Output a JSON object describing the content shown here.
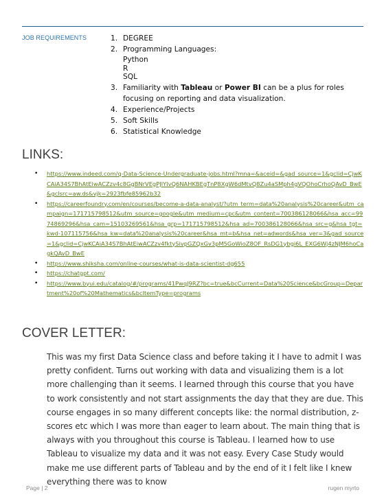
{
  "job_requirements": {
    "label": "JOB REQUIREMENTS",
    "items": [
      {
        "num": "1.",
        "text": "DEGREE"
      },
      {
        "num": "2.",
        "text": "Programming Languages:",
        "sub": [
          "Python",
          "R",
          "SQL"
        ]
      },
      {
        "num": "3.",
        "pre": "Familiarity with ",
        "b1": "Tableau",
        "mid": " or ",
        "b2": "Power BI",
        "post": " can be a plus for roles focusing on reporting and data visualization."
      },
      {
        "num": "4.",
        "text": "Experience/Projects"
      },
      {
        "num": "5.",
        "text": "Soft Skills"
      },
      {
        "num": "6.",
        "text": "Statistical Knowledge"
      }
    ]
  },
  "links": {
    "heading": "LINKS:",
    "bullet": "•",
    "items": [
      "https://www.indeed.com/q-Data-Science-Undergraduate-jobs.html?mna=&aceid=&gad_source=1&gclid=CjwKCAiA34S7BhAtEiwACZzv4c8GgBNrVEgPJIYIvQ6NAHKBEgTnP8XgW6dMtvQ8Zu4aSMph4gVQOhoCrhoQAvD_BwE&gclsrc=aw.ds&vjk=2923fbfe85962b32",
      "https://careerfoundry.com/en/courses/become-a-data-analyst/?utm_term=data%20analysis%20career&utm_campaign=171715798512&utm_source=google&utm_medium=cpc&utm_content=700386128066&hsa_acc=9974869296&hsa_cam=15103269561&hsa_grp=171715798512&hsa_ad=700386128066&hsa_src=g&hsa_tgt=kwd-107115756&hsa_kw=data%20analysis%20career&hsa_mt=b&hsa_net=adwords&hsa_ver=3&gad_source=1&gclid=CjwKCAiA34S7BhAtEiwACZzv4fktySivpGZQxGv3pM5GoWioZ8OF_RsDG1ybgi6L_EXG6Wj4zNJM6hoCagkQAvD_BwE",
      "https://www.shiksha.com/online-courses/what-is-data-scientist-dg655",
      "https://chatgpt.com/",
      "https://www.byui.edu/catalog/#/programs/41PwqJ9RZ?bc=true&bcCurrent=Data%20Science&bcGroup=Department%20of%20Mathematics&bcItemType=programs"
    ]
  },
  "cover_letter": {
    "heading": "COVER LETTER:",
    "text": "This was my first Data Science class and before taking it I have to admit I was pretty confident. Turns out working with data and visualizing them is a lot more challenging than it seems. I learned through this course that you have to work consistently and not start assignments the day that they are due. This course engages in so many different concepts like: the normal distribution, z-scores etc which I was more than eager to learn about. The main thing that is always with you throughout this course is Tableau. I learned how to use Tableau to visualize my data and it was not easy. Every Case Study would make me use different parts of Tableau and by the end of it I felt like I knew everything there was to know"
  },
  "footer": {
    "page": "Page | 2",
    "author": "rugen myrto"
  },
  "colors": {
    "rule": "#1f5f8b",
    "label": "#2e74b5",
    "link": "#5b7d1a"
  }
}
